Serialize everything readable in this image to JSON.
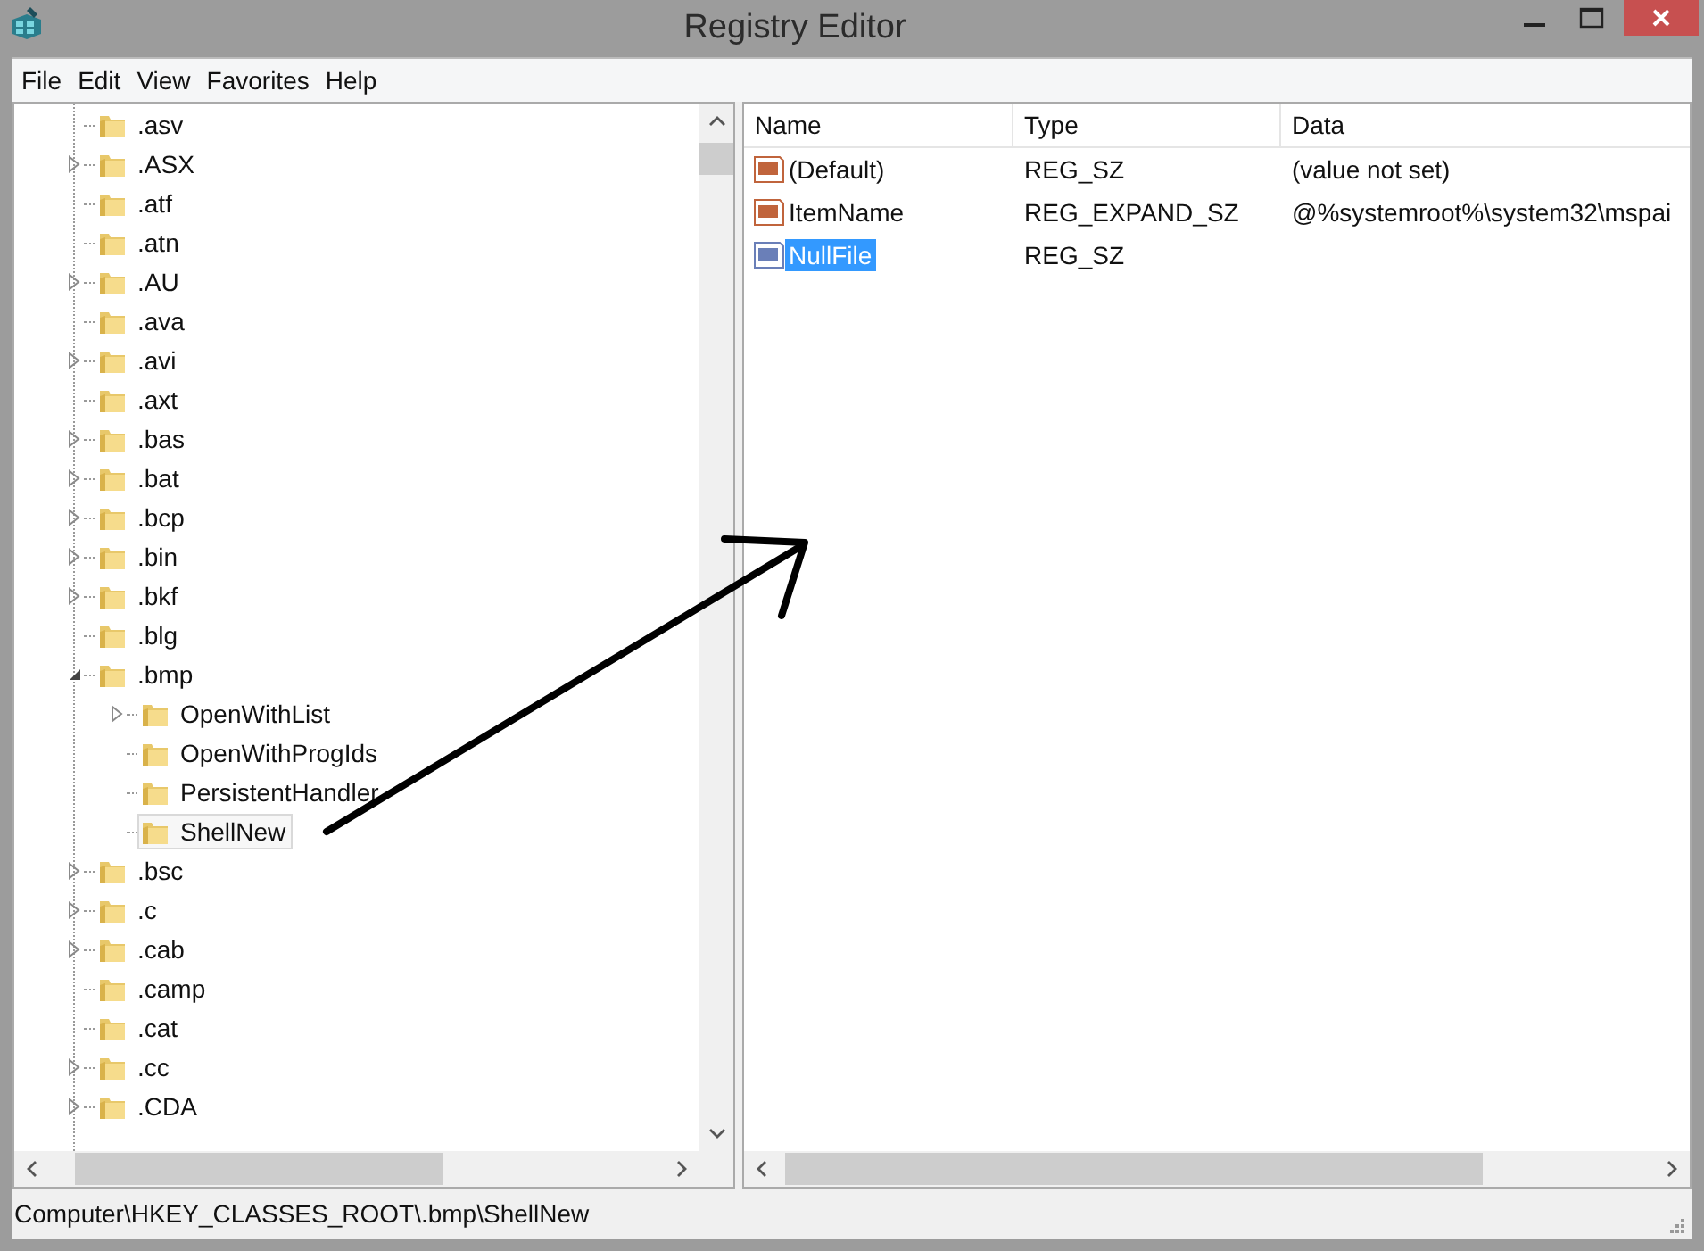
{
  "window": {
    "title": "Registry Editor"
  },
  "menu": [
    "File",
    "Edit",
    "View",
    "Favorites",
    "Help"
  ],
  "tree": [
    {
      "label": ".asv",
      "expandable": false,
      "selected": false
    },
    {
      "label": ".ASX",
      "expandable": true,
      "expanded": false,
      "selected": false
    },
    {
      "label": ".atf",
      "expandable": false,
      "selected": false
    },
    {
      "label": ".atn",
      "expandable": false,
      "selected": false
    },
    {
      "label": ".AU",
      "expandable": true,
      "expanded": false,
      "selected": false
    },
    {
      "label": ".ava",
      "expandable": false,
      "selected": false
    },
    {
      "label": ".avi",
      "expandable": true,
      "expanded": false,
      "selected": false
    },
    {
      "label": ".axt",
      "expandable": false,
      "selected": false
    },
    {
      "label": ".bas",
      "expandable": true,
      "expanded": false,
      "selected": false
    },
    {
      "label": ".bat",
      "expandable": true,
      "expanded": false,
      "selected": false
    },
    {
      "label": ".bcp",
      "expandable": true,
      "expanded": false,
      "selected": false
    },
    {
      "label": ".bin",
      "expandable": true,
      "expanded": false,
      "selected": false
    },
    {
      "label": ".bkf",
      "expandable": true,
      "expanded": false,
      "selected": false
    },
    {
      "label": ".blg",
      "expandable": false,
      "selected": false
    },
    {
      "label": ".bmp",
      "expandable": true,
      "expanded": true,
      "selected": false,
      "children": [
        {
          "label": "OpenWithList",
          "expandable": true,
          "expanded": false,
          "selected": false
        },
        {
          "label": "OpenWithProgIds",
          "expandable": false,
          "selected": false
        },
        {
          "label": "PersistentHandler",
          "expandable": false,
          "selected": false
        },
        {
          "label": "ShellNew",
          "expandable": false,
          "selected": true
        }
      ]
    },
    {
      "label": ".bsc",
      "expandable": true,
      "expanded": false,
      "selected": false
    },
    {
      "label": ".c",
      "expandable": true,
      "expanded": false,
      "selected": false
    },
    {
      "label": ".cab",
      "expandable": true,
      "expanded": false,
      "selected": false
    },
    {
      "label": ".camp",
      "expandable": false,
      "selected": false
    },
    {
      "label": ".cat",
      "expandable": false,
      "selected": false
    },
    {
      "label": ".cc",
      "expandable": true,
      "expanded": false,
      "selected": false
    },
    {
      "label": ".CDA",
      "expandable": true,
      "expanded": false,
      "selected": false
    }
  ],
  "values": {
    "columns": [
      "Name",
      "Type",
      "Data"
    ],
    "rows": [
      {
        "name": "(Default)",
        "type": "REG_SZ",
        "data": "(value not set)",
        "selected": false
      },
      {
        "name": "ItemName",
        "type": "REG_EXPAND_SZ",
        "data": "@%systemroot%\\system32\\mspai",
        "selected": false
      },
      {
        "name": "NullFile",
        "type": "REG_SZ",
        "selected": true
      }
    ]
  },
  "status_bar": "Computer\\HKEY_CLASSES_ROOT\\.bmp\\ShellNew"
}
